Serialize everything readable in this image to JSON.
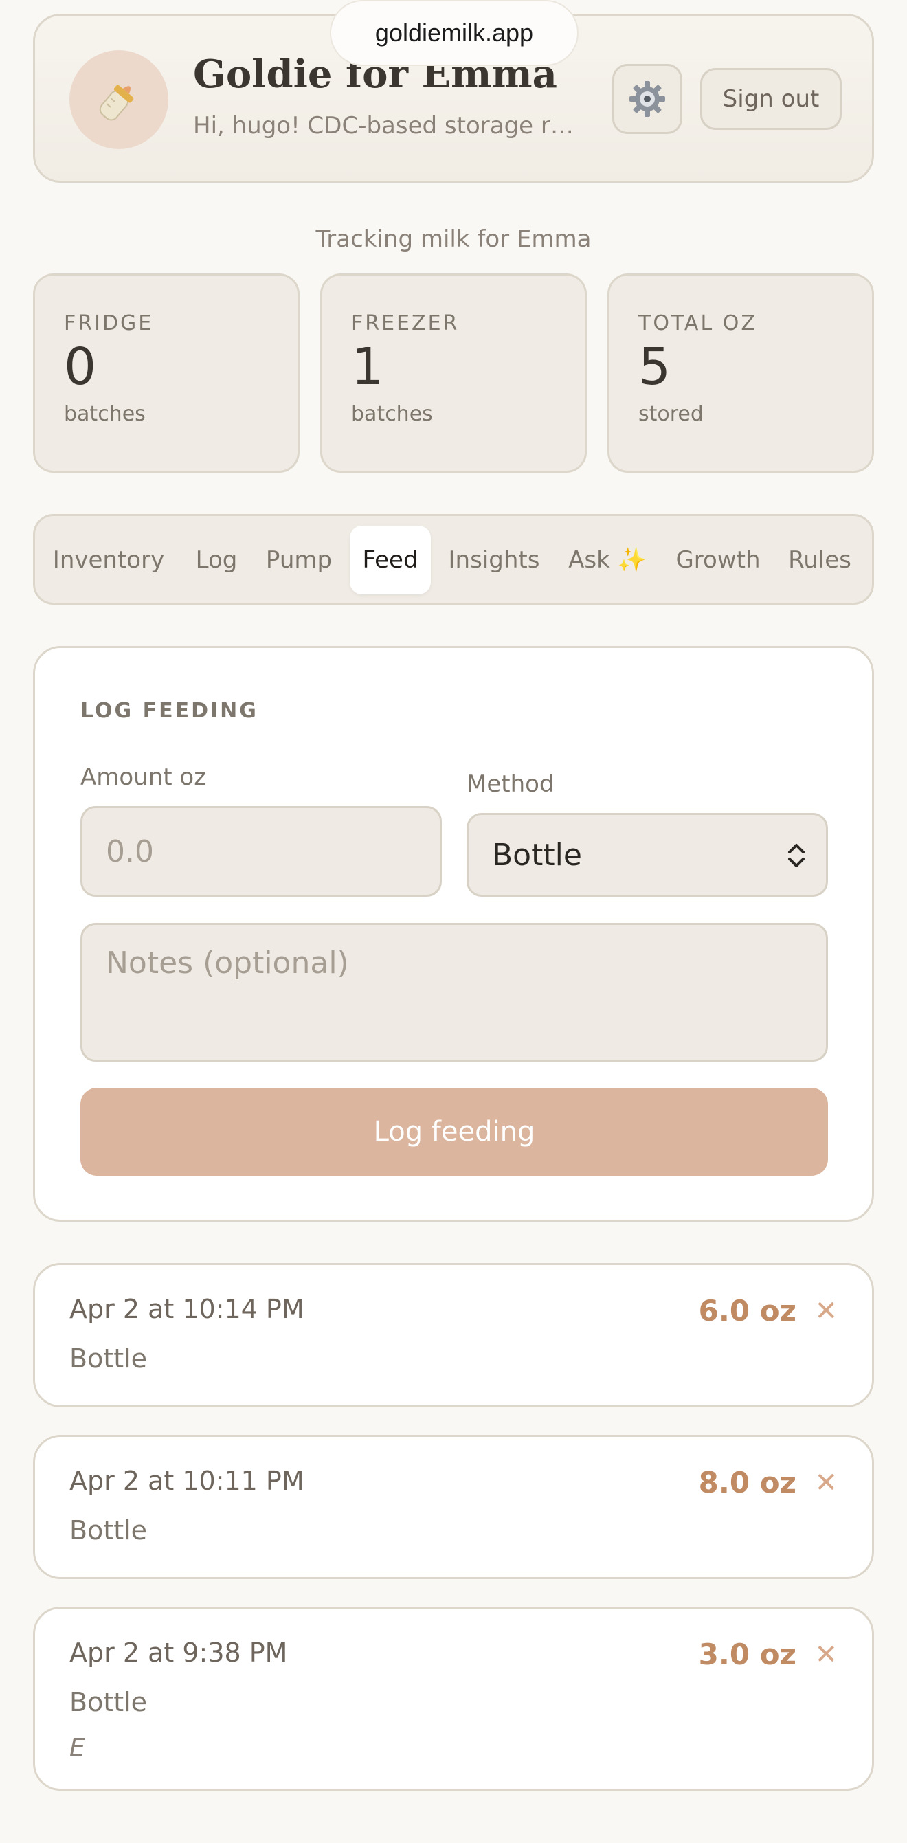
{
  "browser": {
    "url": "goldiemilk.app"
  },
  "header": {
    "avatar_icon": "baby-bottle-icon",
    "title": "Goldie for Emma",
    "subtitle": "Hi, hugo! CDC-based storage rul...",
    "settings_icon": "gear-icon",
    "signout_label": "Sign out"
  },
  "tracking_text": "Tracking milk for Emma",
  "stats": [
    {
      "label": "FRIDGE",
      "value": "0",
      "unit": "batches"
    },
    {
      "label": "FREEZER",
      "value": "1",
      "unit": "batches"
    },
    {
      "label": "TOTAL OZ",
      "value": "5",
      "unit": "stored"
    }
  ],
  "tabs": [
    {
      "label": "Inventory",
      "active": false
    },
    {
      "label": "Log",
      "active": false
    },
    {
      "label": "Pump",
      "active": false
    },
    {
      "label": "Feed",
      "active": true
    },
    {
      "label": "Insights",
      "active": false
    },
    {
      "label": "Ask ✨",
      "active": false
    },
    {
      "label": "Growth",
      "active": false
    },
    {
      "label": "Rules",
      "active": false
    }
  ],
  "feed_form": {
    "section_title": "LOG FEEDING",
    "amount_label": "Amount oz",
    "amount_placeholder": "0.0",
    "method_label": "Method",
    "method_value": "Bottle",
    "notes_placeholder": "Notes (optional)",
    "submit_label": "Log feeding"
  },
  "entries": [
    {
      "date": "Apr 2 at 10:14 PM",
      "method": "Bottle",
      "amount": "6.0 oz",
      "note": ""
    },
    {
      "date": "Apr 2 at 10:11 PM",
      "method": "Bottle",
      "amount": "8.0 oz",
      "note": ""
    },
    {
      "date": "Apr 2 at 9:38 PM",
      "method": "Bottle",
      "amount": "3.0 oz",
      "note": "E"
    }
  ],
  "colors": {
    "accent": "#c08a63",
    "button": "#dbb59e",
    "background": "#faf8f4",
    "card_border": "#dcd6cb"
  }
}
